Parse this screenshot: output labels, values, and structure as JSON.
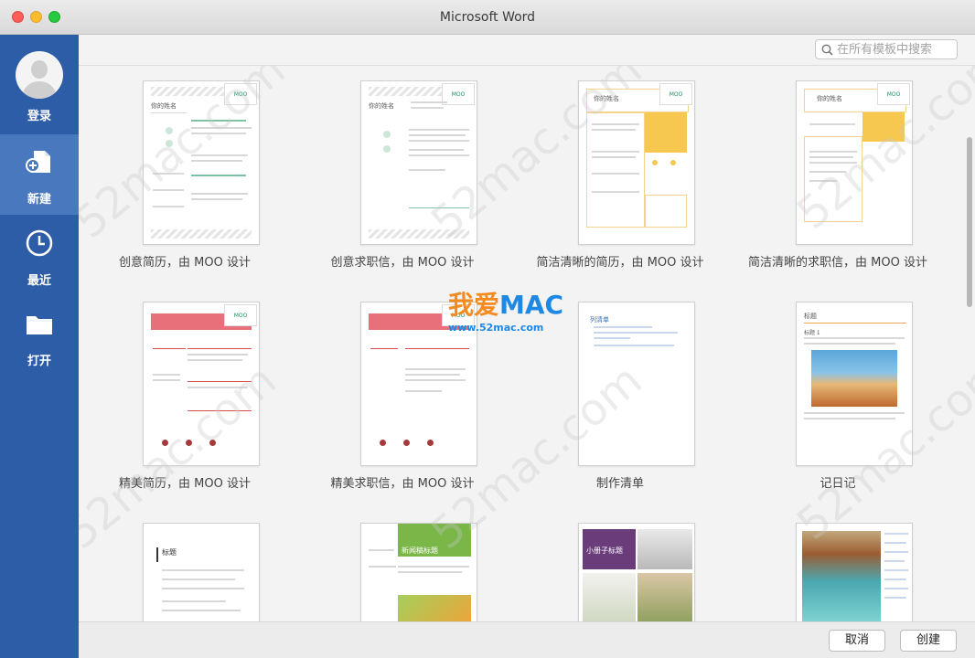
{
  "window": {
    "title": "Microsoft Word"
  },
  "sidebar": {
    "items": [
      {
        "label": "登录",
        "icon": "avatar"
      },
      {
        "label": "新建",
        "icon": "new-document-icon",
        "active": true
      },
      {
        "label": "最近",
        "icon": "clock-icon"
      },
      {
        "label": "打开",
        "icon": "folder-icon"
      }
    ]
  },
  "search": {
    "placeholder": "在所有模板中搜索"
  },
  "templates": [
    {
      "caption": "创意简历，由 MOO 设计"
    },
    {
      "caption": "创意求职信，由 MOO 设计"
    },
    {
      "caption": "简洁清晰的简历，由 MOO 设计"
    },
    {
      "caption": "简洁清晰的求职信，由 MOO 设计"
    },
    {
      "caption": "精美简历，由 MOO 设计"
    },
    {
      "caption": "精美求职信，由 MOO 设计"
    },
    {
      "caption": "制作清单"
    },
    {
      "caption": "记日记"
    }
  ],
  "thumb_text": {
    "your_name": "你的姓名",
    "moo": "MOO",
    "list_title": "列清单",
    "journal_title": "标题",
    "journal_heading": "标题 1",
    "third_row_title": "标题",
    "newsletter_title": "新闻稿标题",
    "brochure_title": "小册子标题"
  },
  "watermark": {
    "brand_cn": "我爱",
    "brand_en": "MAC",
    "url": "www.52mac.com",
    "diagonal": "52mac.com"
  },
  "buttons": {
    "cancel": "取消",
    "create": "创建"
  },
  "colors": {
    "sidebar": "#2e5da7",
    "sidebar_active": "#4a78bf",
    "moo_green": "#1e8f5f",
    "accent_red": "#d94c4c",
    "accent_yellow": "#f7c84f",
    "accent_green": "#7ab648",
    "accent_purple": "#6a3d7a"
  }
}
